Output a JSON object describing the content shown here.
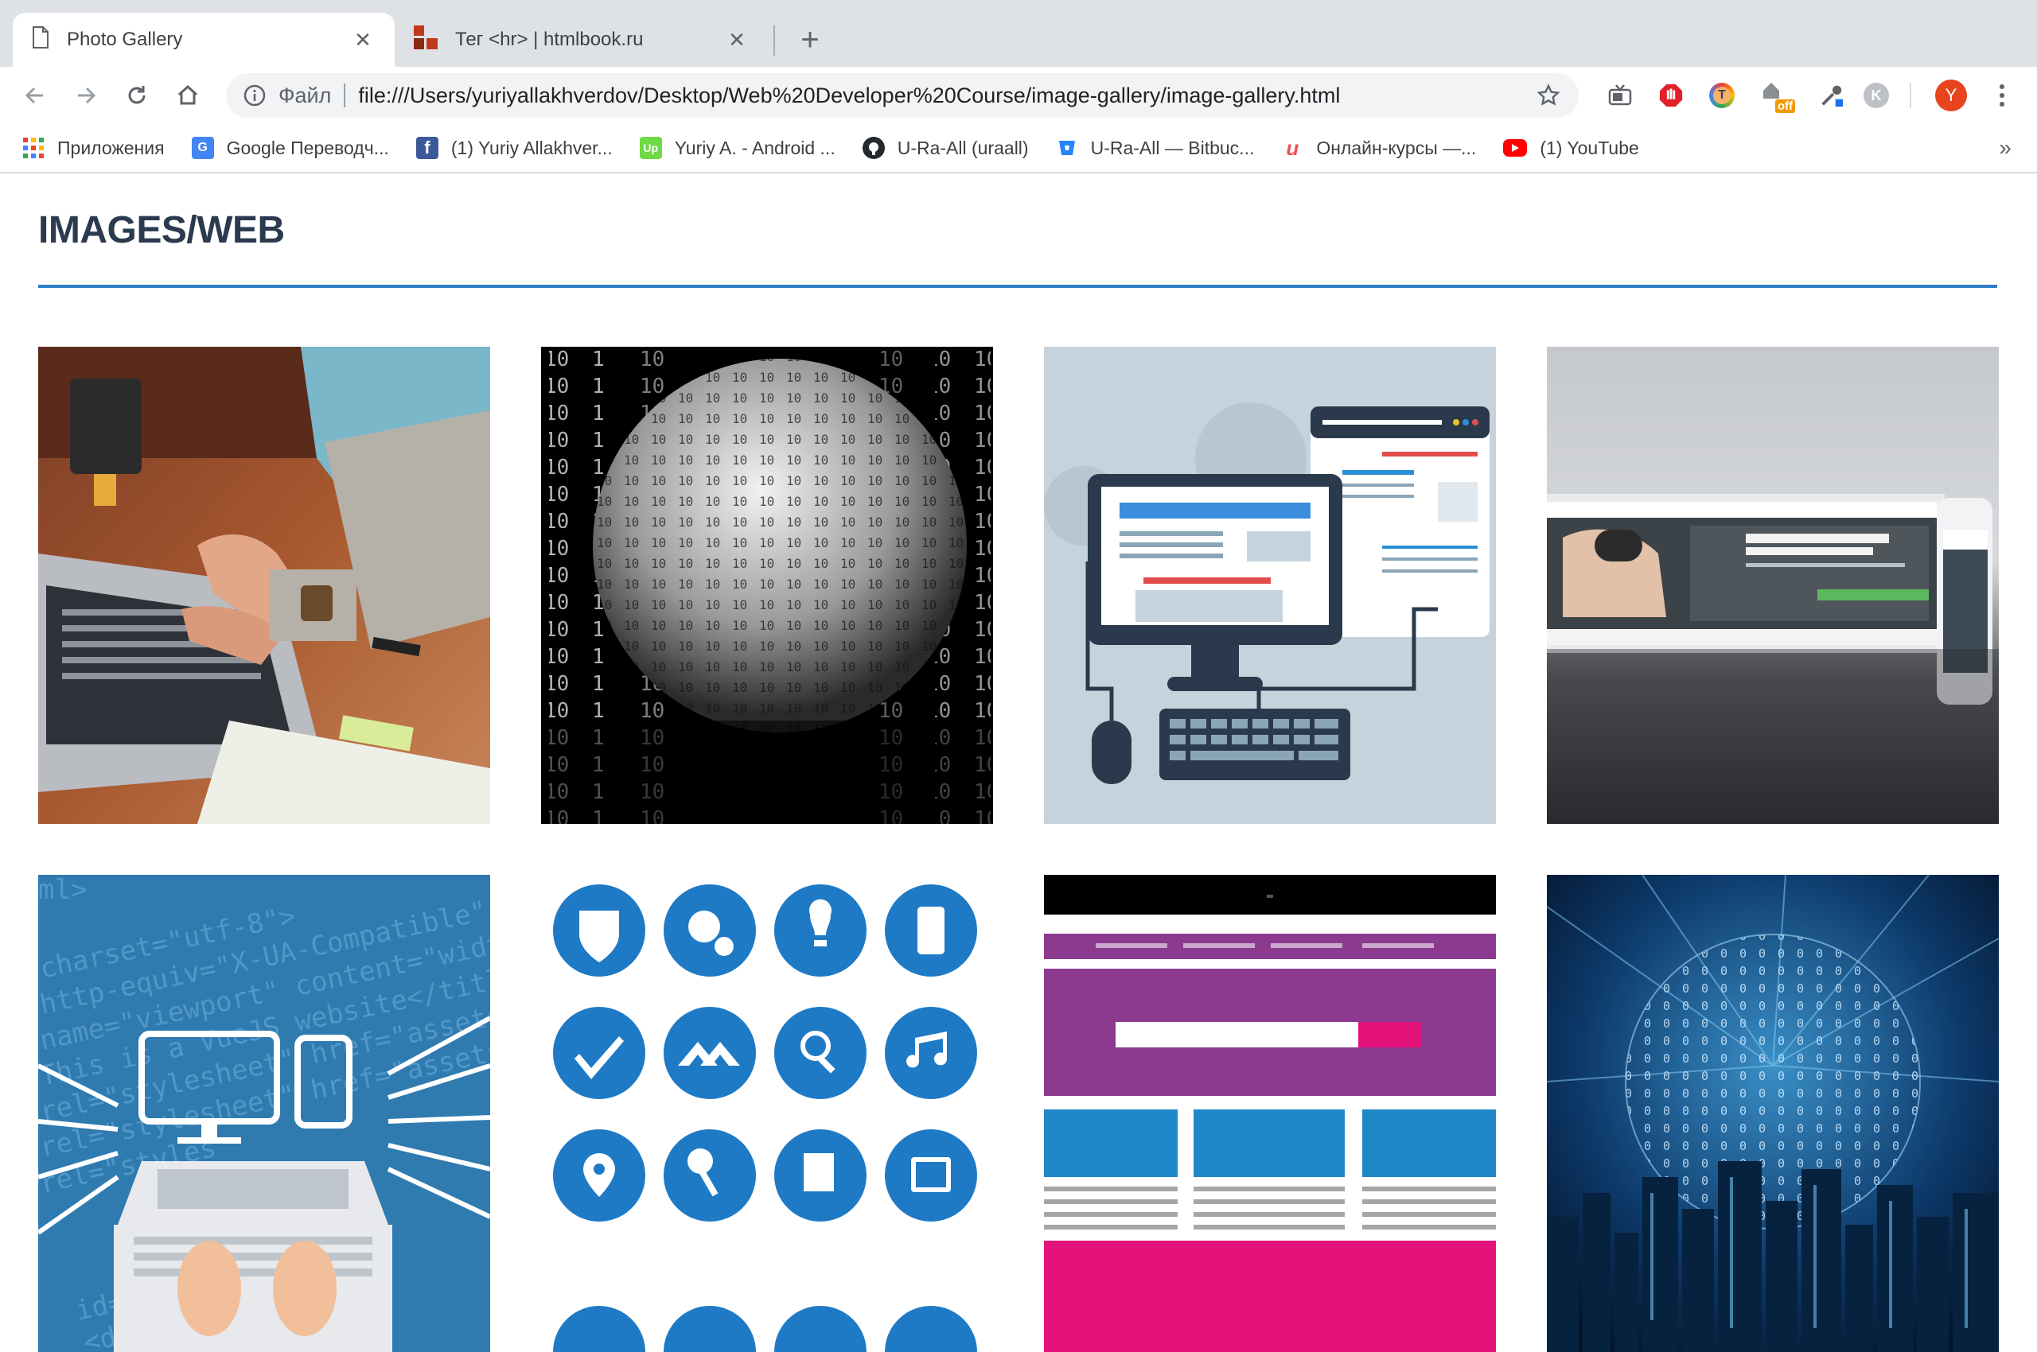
{
  "browser": {
    "tabs": [
      {
        "title": "Photo Gallery",
        "active": true
      },
      {
        "title": "Тег <hr> | htmlbook.ru",
        "active": false
      }
    ],
    "new_tab_label": "+",
    "omnibox": {
      "scheme_label": "Файл",
      "url": "file:///Users/yuriyallakhverdov/Desktop/Web%20Developer%20Course/image-gallery/image-gallery.html"
    },
    "profile_initial": "Y",
    "extensions_badge": "off"
  },
  "bookmarks": [
    {
      "label": "Приложения",
      "icon": "apps-grid-icon"
    },
    {
      "label": "Google Переводч...",
      "icon": "google-translate-icon"
    },
    {
      "label": "(1) Yuriy Allakhver...",
      "icon": "facebook-icon"
    },
    {
      "label": "Yuriy A. - Android ...",
      "icon": "upwork-icon"
    },
    {
      "label": "U-Ra-All (uraall)",
      "icon": "github-icon"
    },
    {
      "label": "U-Ra-All — Bitbuc...",
      "icon": "bitbucket-icon"
    },
    {
      "label": "Онлайн-курсы —...",
      "icon": "udemy-icon"
    },
    {
      "label": "(1) YouTube",
      "icon": "youtube-icon"
    }
  ],
  "bookmarks_more": "»",
  "page": {
    "heading": "IMAGES/WEB"
  },
  "gallery": [
    {
      "name": "laptop-typing-photo"
    },
    {
      "name": "binary-sphere-image"
    },
    {
      "name": "computer-workstation-illustration"
    },
    {
      "name": "tablet-phone-website-photo"
    },
    {
      "name": "html-code-devices-illustration"
    },
    {
      "name": "blue-icons-grid-image"
    },
    {
      "name": "website-wireframe-illustration"
    },
    {
      "name": "binary-city-globe-image"
    }
  ],
  "colors": {
    "accent": "#2d7fc4",
    "heading": "#2b3a4f",
    "tabstrip": "#dee1e6",
    "profile": "#e8451e"
  }
}
